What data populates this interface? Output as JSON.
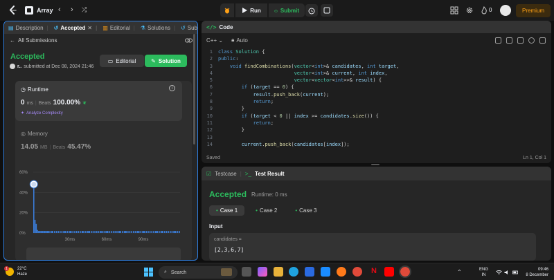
{
  "topbar": {
    "problem_list_label": "Array",
    "run_label": "Run",
    "submit_label": "Submit",
    "streak_count": "0",
    "premium_label": "Premium"
  },
  "left": {
    "tabs": [
      {
        "label": "Description"
      },
      {
        "label": "Accepted"
      },
      {
        "label": "Editorial"
      },
      {
        "label": "Solutions"
      },
      {
        "label": "Subm"
      }
    ],
    "back_label": "All Submissions",
    "status": "Accepted",
    "user_name": "r..",
    "submitted_text": "submitted at Dec 08, 2024 21:46",
    "editorial_btn": "Editorial",
    "solution_btn": "Solution",
    "runtime": {
      "title": "Runtime",
      "value": "0",
      "unit": "ms",
      "beats_label": "Beats",
      "beats_value": "100.00%",
      "analyze_label": "Analyze Complexity"
    },
    "memory": {
      "title": "Memory",
      "value": "14.05",
      "unit": "MB",
      "beats_label": "Beats",
      "beats_value": "45.47%"
    }
  },
  "chart_data": {
    "type": "bar",
    "ylabel": "",
    "xlabel": "",
    "y_ticks": [
      "60%",
      "40%",
      "20%",
      "0%"
    ],
    "x_ticks": [
      "30ms",
      "60ms",
      "90ms"
    ],
    "ylim": [
      0,
      60
    ],
    "xlim": [
      0,
      120
    ],
    "x": [
      0,
      1,
      2,
      3,
      4,
      5,
      6,
      7,
      8,
      9,
      10,
      12,
      15,
      20,
      25,
      30,
      35,
      40,
      45,
      50,
      55,
      60,
      65,
      70,
      75,
      80,
      85,
      90,
      95,
      100,
      105,
      110,
      115
    ],
    "values": [
      44,
      13,
      9,
      3,
      2,
      2,
      2,
      2,
      2,
      2,
      2,
      2,
      2,
      2,
      2,
      2,
      2,
      2,
      2,
      2,
      2,
      2,
      2,
      2,
      2,
      2,
      2,
      2,
      2,
      2,
      2,
      2,
      2
    ],
    "highlight_x": 0
  },
  "code": {
    "header": "Code",
    "language": "C++",
    "mode": "Auto",
    "status_left": "Saved",
    "status_right": "Ln 1, Col 1",
    "lines": [
      {
        "n": "1",
        "html": "<span class=\"kw\">class</span> <span class=\"ty\">Solution</span> {"
      },
      {
        "n": "2",
        "html": "<span class=\"kw\">public</span>:"
      },
      {
        "n": "3",
        "html": "    <span class=\"kw\">void</span> <span class=\"fn\">findCombinations</span>(<span class=\"ty\">vector</span>&lt;<span class=\"kw\">int</span>&gt;&amp; <span class=\"vr\">candidates</span>, <span class=\"kw\">int</span> <span class=\"vr\">target</span>,"
      },
      {
        "n": "4",
        "html": "                          <span class=\"ty\">vector</span>&lt;<span class=\"kw\">int</span>&gt;&amp; <span class=\"vr\">current</span>, <span class=\"kw\">int</span> <span class=\"vr\">index</span>,"
      },
      {
        "n": "5",
        "html": "                          <span class=\"ty\">vector</span>&lt;<span class=\"ty\">vector</span>&lt;<span class=\"kw\">int</span>&gt;&gt;&amp; <span class=\"vr\">result</span>) {"
      },
      {
        "n": "6",
        "html": "        <span class=\"kw\">if</span> (<span class=\"vr\">target</span> == <span class=\"nm\">0</span>) {"
      },
      {
        "n": "7",
        "html": "            <span class=\"vr\">result</span>.<span class=\"fn\">push_back</span>(<span class=\"vr\">current</span>);"
      },
      {
        "n": "8",
        "html": "            <span class=\"kw\">return</span>;"
      },
      {
        "n": "9",
        "html": "        }"
      },
      {
        "n": "10",
        "html": "        <span class=\"kw\">if</span> (<span class=\"vr\">target</span> &lt; <span class=\"nm\">0</span> || <span class=\"vr\">index</span> &gt;= <span class=\"vr\">candidates</span>.<span class=\"fn\">size</span>()) {"
      },
      {
        "n": "11",
        "html": "            <span class=\"kw\">return</span>;"
      },
      {
        "n": "12",
        "html": "        }"
      },
      {
        "n": "13",
        "html": ""
      },
      {
        "n": "14",
        "html": "        <span class=\"vr\">current</span>.<span class=\"fn\">push_back</span>(<span class=\"vr\">candidates</span>[<span class=\"vr\">index</span>]);"
      }
    ]
  },
  "result": {
    "tab_testcase": "Testcase",
    "tab_result": "Test Result",
    "status": "Accepted",
    "runtime": "Runtime: 0 ms",
    "cases": [
      "Case 1",
      "Case 2",
      "Case 3"
    ],
    "input_label": "Input",
    "var_name": "candidates =",
    "var_value": "[2,3,6,7]"
  },
  "taskbar": {
    "temperature": "22°C",
    "weather": "Haze",
    "weather_badge": "1",
    "search_placeholder": "Search",
    "lang_top": "ENG",
    "lang_bottom": "IN",
    "time": "09:46",
    "date": "8 December"
  }
}
